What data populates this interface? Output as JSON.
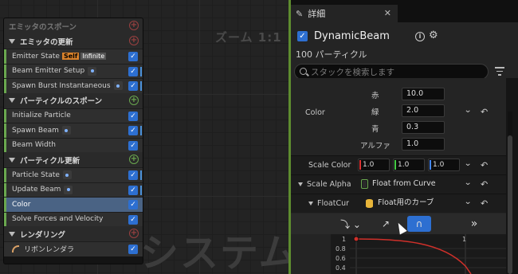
{
  "graph": {
    "zoom_label": "ズーム 1:1",
    "watermark": "システム"
  },
  "node": {
    "sections": {
      "emitter_spawn": "エミッタのスポーン",
      "emitter_update": "エミッタの更新",
      "particle_spawn": "パーティクルのスポーン",
      "particle_update": "パーティクル更新",
      "render": "レンダリング"
    },
    "rows": {
      "emitter_state": "Emitter State",
      "self_badge": "Self",
      "infinite_badge": "Infinite",
      "beam_emitter_setup": "Beam Emitter Setup",
      "spawn_burst": "Spawn Burst Instantaneous",
      "initialize_particle": "Initialize Particle",
      "spawn_beam": "Spawn Beam",
      "beam_width": "Beam Width",
      "particle_state": "Particle State",
      "update_beam": "Update Beam",
      "color": "Color",
      "solve_forces": "Solve Forces and Velocity",
      "ribbon_renderer": "リボンレンダラ"
    },
    "check_glyph": "✓"
  },
  "panel": {
    "tab_label": "詳細",
    "emitter_name": "DynamicBeam",
    "particle_count": "100 パーティクル",
    "search_placeholder": "スタックを検索します",
    "color": {
      "label": "Color",
      "r_label": "赤",
      "r_value": "10.0",
      "g_label": "緑",
      "g_value": "2.0",
      "b_label": "青",
      "b_value": "0.3",
      "a_label": "アルファ",
      "a_value": "1.0"
    },
    "scale_color": {
      "label": "Scale Color",
      "r": "1.0",
      "g": "1.0",
      "b": "1.0"
    },
    "scale_alpha": {
      "label": "Scale Alpha",
      "value": "Float from Curve"
    },
    "float_curve": {
      "label": "FloatCur",
      "value": "Float用のカーブ"
    },
    "curve_ticks": [
      "1",
      "0.8",
      "0.6",
      "0.4"
    ],
    "curve_top_label": "1"
  },
  "colors": {
    "accent_blue": "#2d6fd1",
    "module_green": "#6aa84f",
    "selection": "#4a6384",
    "curve_red": "#d0302a"
  }
}
